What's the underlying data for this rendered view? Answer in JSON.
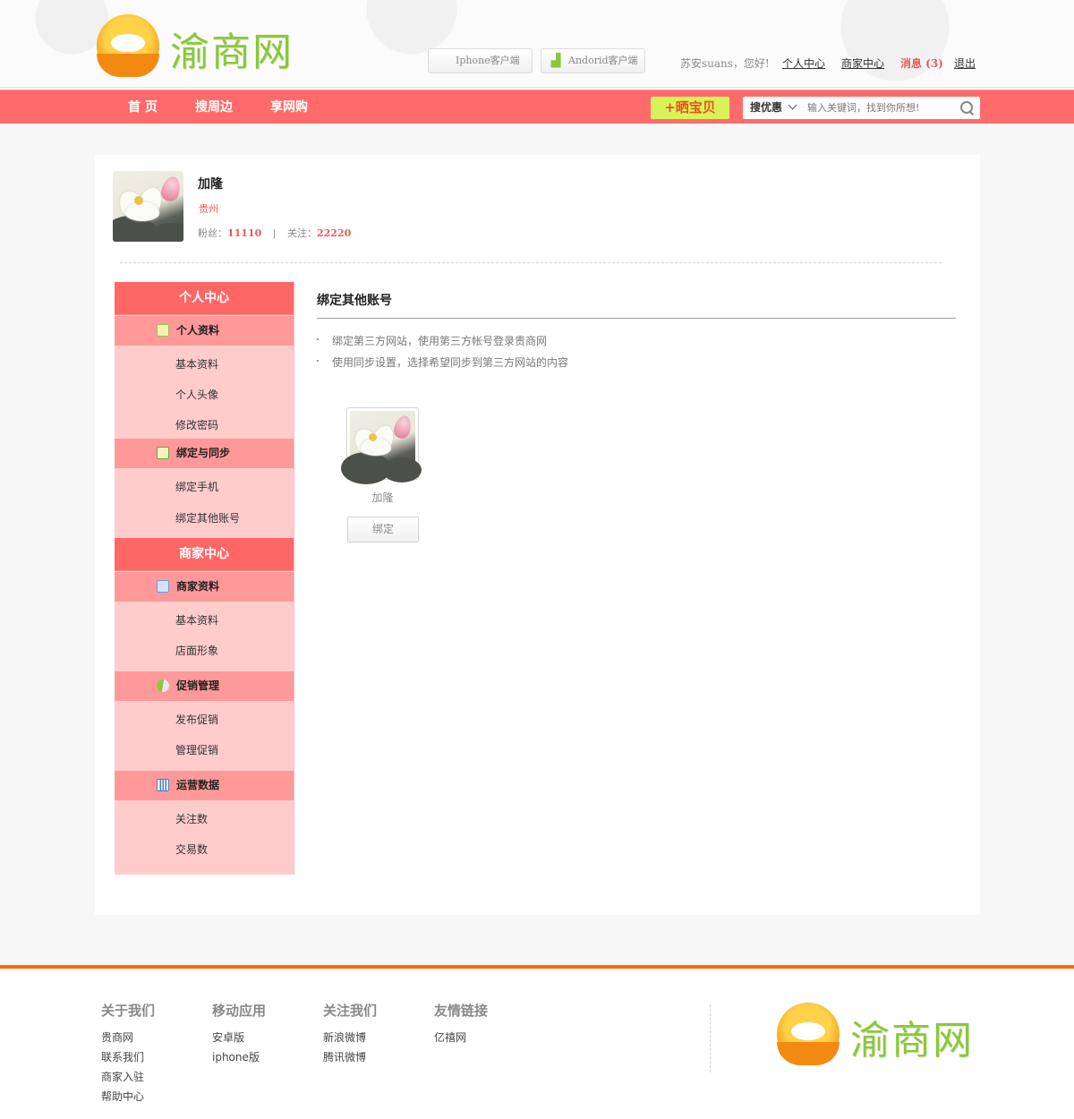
{
  "header": {
    "logo_text": "渝商网",
    "iphone_client": "Iphone客户端",
    "android_client": "Andorid客户端",
    "greeting": "苏安suans，您好!",
    "personal_center": "个人中心",
    "merchant_center": "商家中心",
    "messages": "消息 (3)",
    "logout": "退出"
  },
  "nav": {
    "items": [
      "首 页",
      "搜周边",
      "享网购"
    ],
    "share_button": "+晒宝贝",
    "search_type": "搜优惠",
    "search_placeholder": "输入关键词，找到你所想!"
  },
  "profile": {
    "name": "加隆",
    "city": "贵州",
    "fans_label": "粉丝：",
    "fans": "11110",
    "separator": "|",
    "follow_label": "关注：",
    "follow": "22220"
  },
  "sidebar": {
    "personal_head": "个人中心",
    "groups": [
      {
        "label": "个人资料",
        "items": [
          "基本资料",
          "个人头像",
          "修改密码"
        ]
      },
      {
        "label": "绑定与同步",
        "items": [
          "绑定手机",
          "绑定其他账号"
        ]
      }
    ],
    "merchant_head": "商家中心",
    "merchant_groups": [
      {
        "label": "商家资料",
        "items": [
          "基本资料",
          "店面形象"
        ]
      },
      {
        "label": "促销管理",
        "items": [
          "发布促销",
          "管理促销"
        ]
      },
      {
        "label": "运营数据",
        "items": [
          "关注数",
          "交易数"
        ]
      }
    ]
  },
  "content": {
    "title": "绑定其他账号",
    "tips": [
      "绑定第三方网站，使用第三方帐号登录贵商网",
      "使用同步设置，选择希望同步到第三方网站的内容"
    ],
    "account_name": "加隆",
    "bind_button": "绑定"
  },
  "footer": {
    "columns": [
      {
        "title": "关于我们",
        "links": [
          "贵商网",
          "联系我们",
          "商家入驻",
          "帮助中心"
        ]
      },
      {
        "title": "移动应用",
        "links": [
          "安卓版",
          "iphone版"
        ]
      },
      {
        "title": "关注我们",
        "links": [
          "新浪微博",
          "腾讯微博"
        ]
      },
      {
        "title": "友情链接",
        "links": [
          "亿禧网"
        ]
      }
    ],
    "logo_text": "渝商网"
  },
  "colors": {
    "nav": "#ff6b6b",
    "sidebar_head": "#ff6666",
    "sidebar_group": "#ff9999",
    "sidebar_bg": "#ffcccc",
    "accent_red": "#e85a5a",
    "share_btn": "#d8f35a",
    "footer_line": "#ff6a00",
    "logo_green": "#8cc63f"
  }
}
